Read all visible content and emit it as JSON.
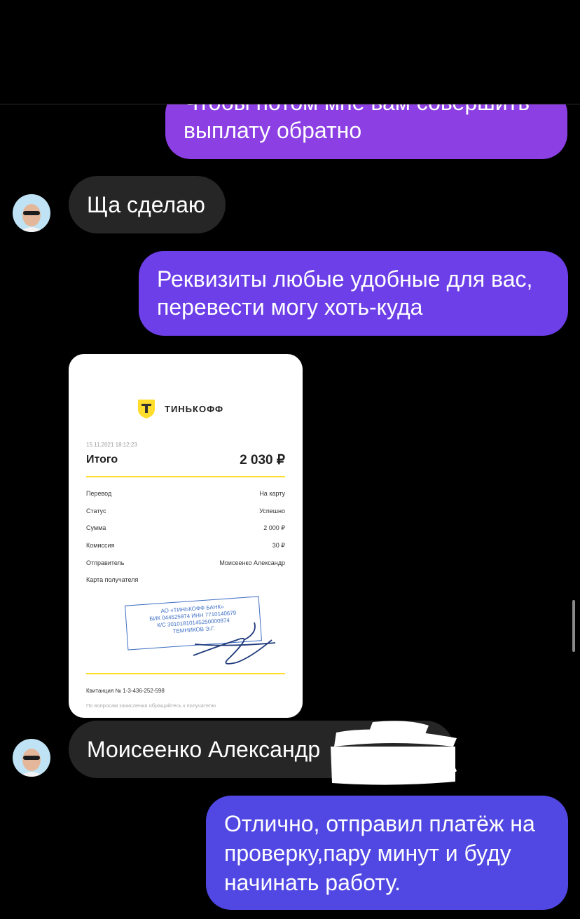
{
  "messages": {
    "m1_cut": "Чтобы потом мне вам совершить",
    "m1_line2": "выплату обратно",
    "m2": "Ща сделаю",
    "m3_line1": "Реквизиты любые удобные для вас,",
    "m3_line2": "перевести могу хоть-куда",
    "m5": "Моисеенко Александр",
    "m6_line1": "Отлично, отправил платёж на",
    "m6_line2": "проверку,пару минут и буду",
    "m6_line3": "начинать работу."
  },
  "receipt": {
    "bank": "ТИНЬКОФФ",
    "datetime": "15.11.2021  18:12:23",
    "total_label": "Итого",
    "total_value": "2 030 ₽",
    "rows": [
      {
        "label": "Перевод",
        "value": "На карту"
      },
      {
        "label": "Статус",
        "value": "Успешно"
      },
      {
        "label": "Сумма",
        "value": "2 000 ₽"
      },
      {
        "label": "Комиссия",
        "value": "30 ₽"
      },
      {
        "label": "Отправитель",
        "value": "Моисеенко Александр"
      },
      {
        "label": "Карта получателя",
        "value": ""
      }
    ],
    "stamp": {
      "line1": "АО «ТИНЬКОФФ БАНК»",
      "line2": "БИК 044525974  ИНН 7710140679",
      "line3": "К/С 30101810145250000974",
      "line4": "ТЕМНИКОВ Э.Г."
    },
    "receipt_number": "Квитанция  № 1-3-436-252-598",
    "footer_note": "По вопросам зачисления обращайтесь к получателю"
  },
  "colors": {
    "bubble_purple": "#8a3ee0",
    "bubble_violet": "#6a3fe6",
    "bubble_blue": "#5148e2",
    "incoming_bubble": "#262626",
    "tinkoff_yellow": "#ffdd2d"
  }
}
